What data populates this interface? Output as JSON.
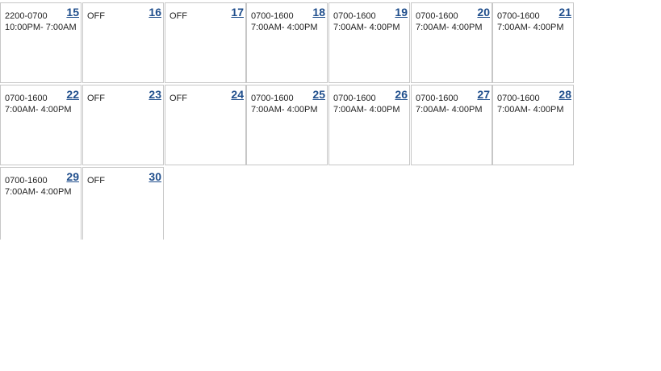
{
  "weeks": [
    {
      "days": [
        {
          "day": "15",
          "code": "2200-0700",
          "time": "10:00PM- 7:00AM"
        },
        {
          "day": "16",
          "code": "OFF",
          "time": ""
        },
        {
          "day": "17",
          "code": "OFF",
          "time": ""
        },
        {
          "day": "18",
          "code": "0700-1600",
          "time": "7:00AM- 4:00PM"
        },
        {
          "day": "19",
          "code": "0700-1600",
          "time": "7:00AM- 4:00PM"
        },
        {
          "day": "20",
          "code": "0700-1600",
          "time": "7:00AM- 4:00PM"
        },
        {
          "day": "21",
          "code": "0700-1600",
          "time": "7:00AM- 4:00PM"
        }
      ]
    },
    {
      "days": [
        {
          "day": "22",
          "code": "0700-1600",
          "time": "7:00AM- 4:00PM"
        },
        {
          "day": "23",
          "code": "OFF",
          "time": ""
        },
        {
          "day": "24",
          "code": "OFF",
          "time": ""
        },
        {
          "day": "25",
          "code": "0700-1600",
          "time": "7:00AM- 4:00PM"
        },
        {
          "day": "26",
          "code": "0700-1600",
          "time": "7:00AM- 4:00PM"
        },
        {
          "day": "27",
          "code": "0700-1600",
          "time": "7:00AM- 4:00PM"
        },
        {
          "day": "28",
          "code": "0700-1600",
          "time": "7:00AM- 4:00PM"
        }
      ]
    },
    {
      "days": [
        {
          "day": "29",
          "code": "0700-1600",
          "time": "7:00AM- 4:00PM"
        },
        {
          "day": "30",
          "code": "OFF",
          "time": ""
        }
      ]
    }
  ],
  "colors": {
    "day_link": "#1f4e8c",
    "border": "#c7c7c7",
    "text": "#222222"
  }
}
